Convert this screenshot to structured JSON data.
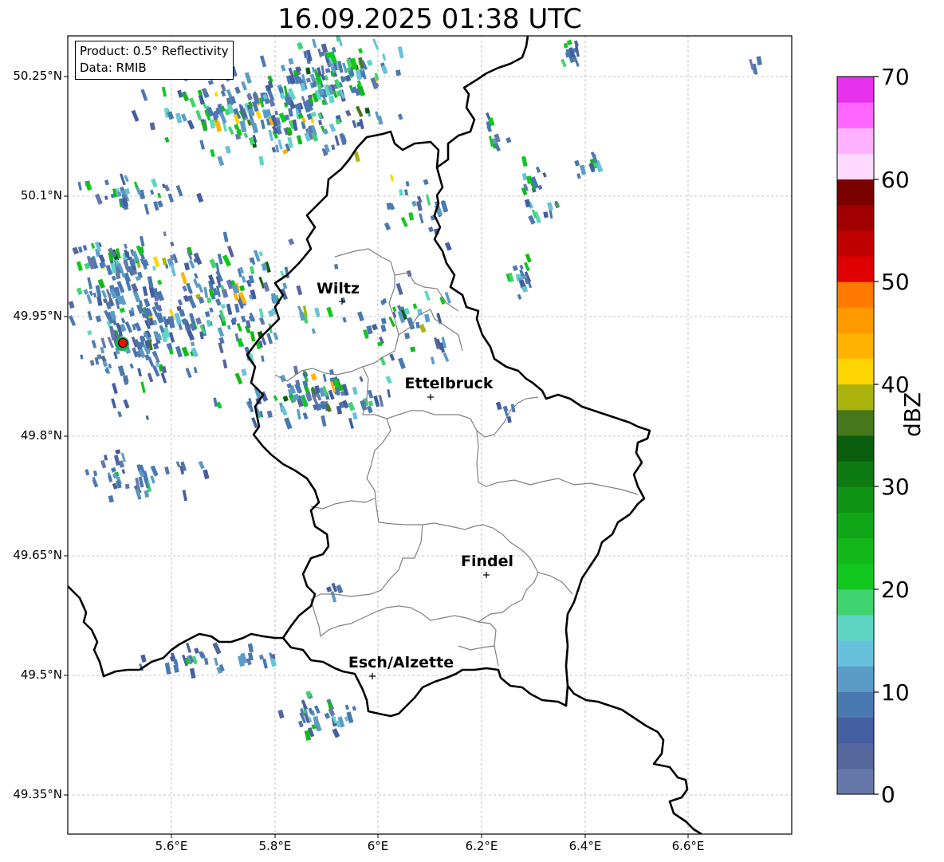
{
  "title": "16.09.2025 01:38 UTC",
  "info": {
    "product": "Product: 0.5° Reflectivity",
    "data": "Data: RMIB"
  },
  "lat_ticks": [
    "50.25°N",
    "50.1°N",
    "49.95°N",
    "49.8°N",
    "49.65°N",
    "49.5°N",
    "49.35°N"
  ],
  "lon_ticks": [
    "5.6°E",
    "5.8°E",
    "6°E",
    "6.2°E",
    "6.4°E",
    "6.6°E"
  ],
  "cities": [
    {
      "name": "Wiltz"
    },
    {
      "name": "Ettelbruck"
    },
    {
      "name": "Findel"
    },
    {
      "name": "Esch/Alzette"
    }
  ],
  "colorbar": {
    "unit": "dBZ",
    "ticks": [
      "0",
      "10",
      "20",
      "30",
      "40",
      "50",
      "60",
      "70"
    ],
    "colors": [
      "#6677aa",
      "#55669d",
      "#445ea0",
      "#4a78b0",
      "#5a9cc6",
      "#68c1dc",
      "#5fd6c4",
      "#3fd470",
      "#12c71f",
      "#12b81a",
      "#10a617",
      "#0f9314",
      "#0d7a12",
      "#0a5e0e",
      "#46771a",
      "#abb30c",
      "#ffd500",
      "#ffb300",
      "#ff9900",
      "#ff7a00",
      "#e00000",
      "#c00000",
      "#a00000",
      "#7a0000",
      "#ffd9ff",
      "#ffb0ff",
      "#ff66ff",
      "#e632ee"
    ]
  },
  "radar_site_color": "#ee1100"
}
